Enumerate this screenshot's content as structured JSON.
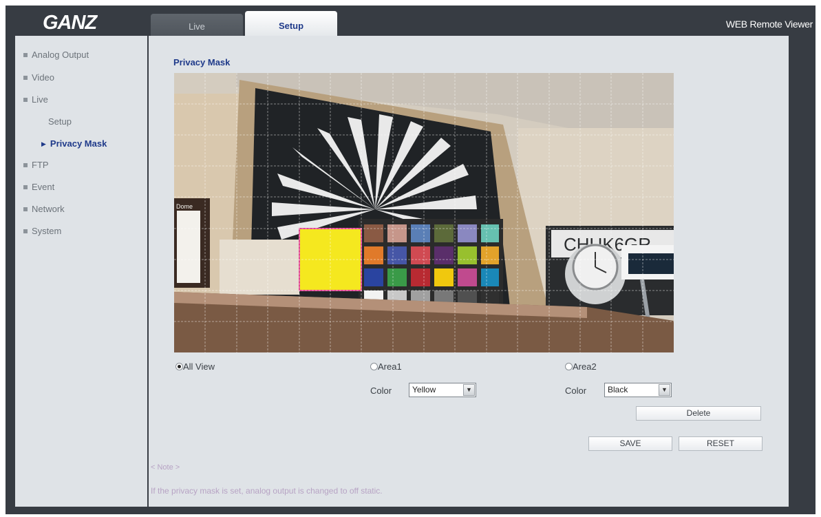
{
  "app": {
    "logo": "GANZ",
    "title": "WEB Remote Viewer"
  },
  "tabs": [
    {
      "label": "Live",
      "active": false
    },
    {
      "label": "Setup",
      "active": true
    }
  ],
  "sidebar": {
    "items": [
      {
        "label": "Analog Output",
        "level": 1
      },
      {
        "label": "Video",
        "level": 1
      },
      {
        "label": "Live",
        "level": 1
      },
      {
        "label": "Setup",
        "level": 2
      },
      {
        "label": "Privacy Mask",
        "level": 2,
        "active": true
      },
      {
        "label": "FTP",
        "level": 1
      },
      {
        "label": "Event",
        "level": 1
      },
      {
        "label": "Network",
        "level": 1
      },
      {
        "label": "System",
        "level": 1
      }
    ]
  },
  "main": {
    "page_title": "Privacy Mask",
    "preview": {
      "mask_color": "#f5e81f",
      "mask_border": "#e0428f",
      "grid_color": "#ffffff"
    },
    "all_view": {
      "label": "All View",
      "checked": true
    },
    "area1": {
      "label": "Area1",
      "checked": false,
      "color_label": "Color",
      "color_value": "Yellow"
    },
    "area2": {
      "label": "Area2",
      "checked": false,
      "color_label": "Color",
      "color_value": "Black"
    },
    "buttons": {
      "delete": "Delete",
      "save": "SAVE",
      "reset": "RESET"
    },
    "note": {
      "heading": "< Note >",
      "text": "If the privacy mask is set, analog output is changed to off static."
    }
  },
  "colors": {
    "frame": "#373c43",
    "panel": "#dfe3e7",
    "accent": "#1f3a8a",
    "note": "#b7a3c4"
  }
}
